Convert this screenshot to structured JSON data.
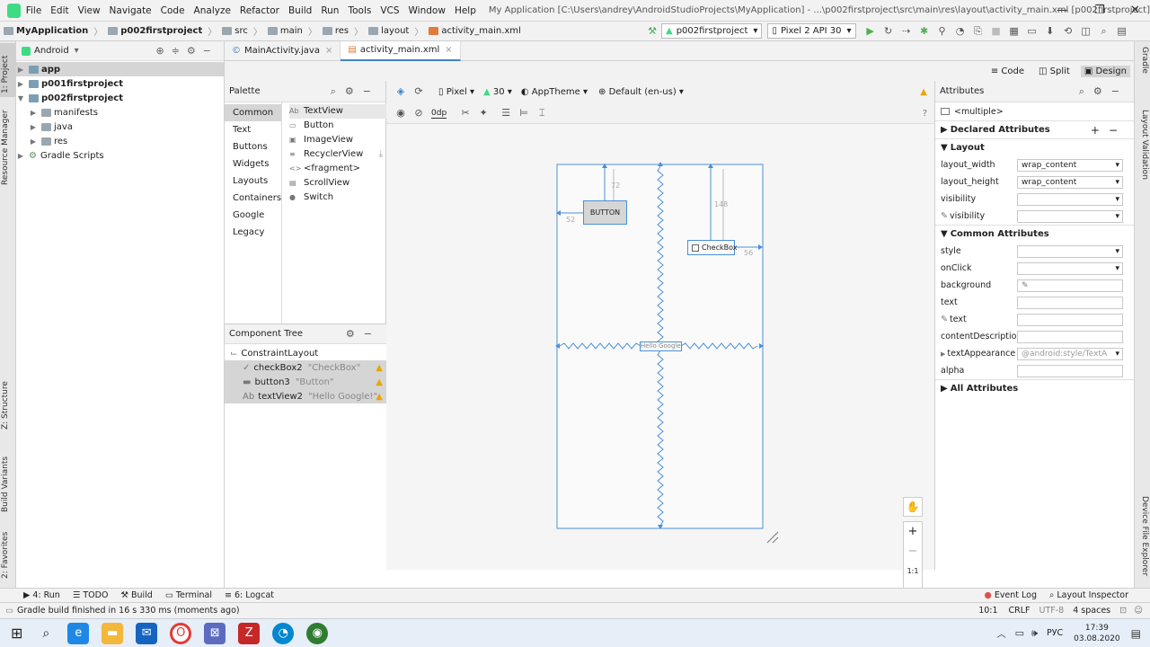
{
  "menubar": {
    "items": [
      "File",
      "Edit",
      "View",
      "Navigate",
      "Code",
      "Analyze",
      "Refactor",
      "Build",
      "Run",
      "Tools",
      "VCS",
      "Window",
      "Help"
    ],
    "title": "My Application [C:\\Users\\andrey\\AndroidStudioProjects\\MyApplication] - ...\\p002firstproject\\src\\main\\res\\layout\\activity_main.xml [p002firstproject]"
  },
  "navbar": {
    "crumbs": [
      "MyApplication",
      "p002firstproject",
      "src",
      "main",
      "res",
      "layout",
      "activity_main.xml"
    ],
    "run_config": "p002firstproject",
    "device": "Pixel 2 API 30"
  },
  "side_left": {
    "project": "1: Project",
    "resource": "Resource Manager",
    "structure": "Z: Structure",
    "variants": "Build Variants",
    "favorites": "2: Favorites"
  },
  "side_right": {
    "gradle": "Gradle",
    "layout_validation": "Layout Validation",
    "device_explorer": "Device File Explorer"
  },
  "project": {
    "view": "Android",
    "tree": [
      "app",
      "p001firstproject",
      "p002firstproject",
      "manifests",
      "java",
      "res",
      "Gradle Scripts"
    ]
  },
  "tabs": [
    "MainActivity.java",
    "activity_main.xml"
  ],
  "modes": [
    "Code",
    "Split",
    "Design"
  ],
  "palette": {
    "title": "Palette",
    "categories": [
      "Common",
      "Text",
      "Buttons",
      "Widgets",
      "Layouts",
      "Containers",
      "Google",
      "Legacy"
    ],
    "items": [
      "TextView",
      "Button",
      "ImageView",
      "RecyclerView",
      "<fragment>",
      "ScrollView",
      "Switch"
    ],
    "item_icons": [
      "Ab",
      "▭",
      "▣",
      "≡",
      "<>",
      "▤",
      "●"
    ]
  },
  "component_tree": {
    "title": "Component Tree",
    "root": "ConstraintLayout",
    "children": [
      {
        "name": "checkBox2",
        "text": "\"CheckBox\""
      },
      {
        "name": "button3",
        "text": "\"Button\""
      },
      {
        "name": "textView2",
        "text": "\"Hello Google!\""
      }
    ]
  },
  "design_toolbar": {
    "device": "Pixel",
    "api": "30",
    "theme": "AppTheme",
    "locale": "Default (en-us)",
    "margin": "0dp"
  },
  "canvas": {
    "button_label": "BUTTON",
    "checkbox_label": "CheckBox",
    "textview_label": "Hello Google!",
    "dim_72": "72",
    "dim_52": "52",
    "dim_148": "148",
    "dim_56": "56"
  },
  "zoom": {
    "plus": "+",
    "minus": "−",
    "ratio": "1:1"
  },
  "attributes": {
    "title": "Attributes",
    "selection": "<multiple>",
    "declared": "Declared Attributes",
    "layout_section": "Layout",
    "layout_rows": [
      {
        "name": "layout_width",
        "value": "wrap_content"
      },
      {
        "name": "layout_height",
        "value": "wrap_content"
      },
      {
        "name": "visibility",
        "value": ""
      },
      {
        "name": "visibility",
        "value": ""
      }
    ],
    "common_section": "Common Attributes",
    "common_rows": [
      {
        "name": "style",
        "value": ""
      },
      {
        "name": "onClick",
        "value": ""
      },
      {
        "name": "background",
        "value": ""
      },
      {
        "name": "text",
        "value": ""
      },
      {
        "name": "text",
        "value": ""
      },
      {
        "name": "contentDescription",
        "value": ""
      },
      {
        "name": "textAppearance",
        "value": "@android:style/TextA"
      },
      {
        "name": "alpha",
        "value": ""
      }
    ],
    "all": "All Attributes"
  },
  "bottom_tools": {
    "run": "4: Run",
    "todo": "TODO",
    "build": "Build",
    "terminal": "Terminal",
    "logcat": "6: Logcat",
    "event_log": "Event Log",
    "layout_inspector": "Layout Inspector"
  },
  "status": {
    "message": "Gradle build finished in 16 s 330 ms (moments ago)",
    "position": "10:1",
    "line_sep": "CRLF",
    "encoding": "UTF-8",
    "indent": "4 spaces"
  },
  "taskbar": {
    "lang": "РУС",
    "time": "17:39",
    "date": "03.08.2020"
  },
  "colors": {
    "accent": "#4083c9",
    "warning": "#e6a700",
    "selection": "#d5d5d5",
    "blueprint": "#4a90d9"
  }
}
